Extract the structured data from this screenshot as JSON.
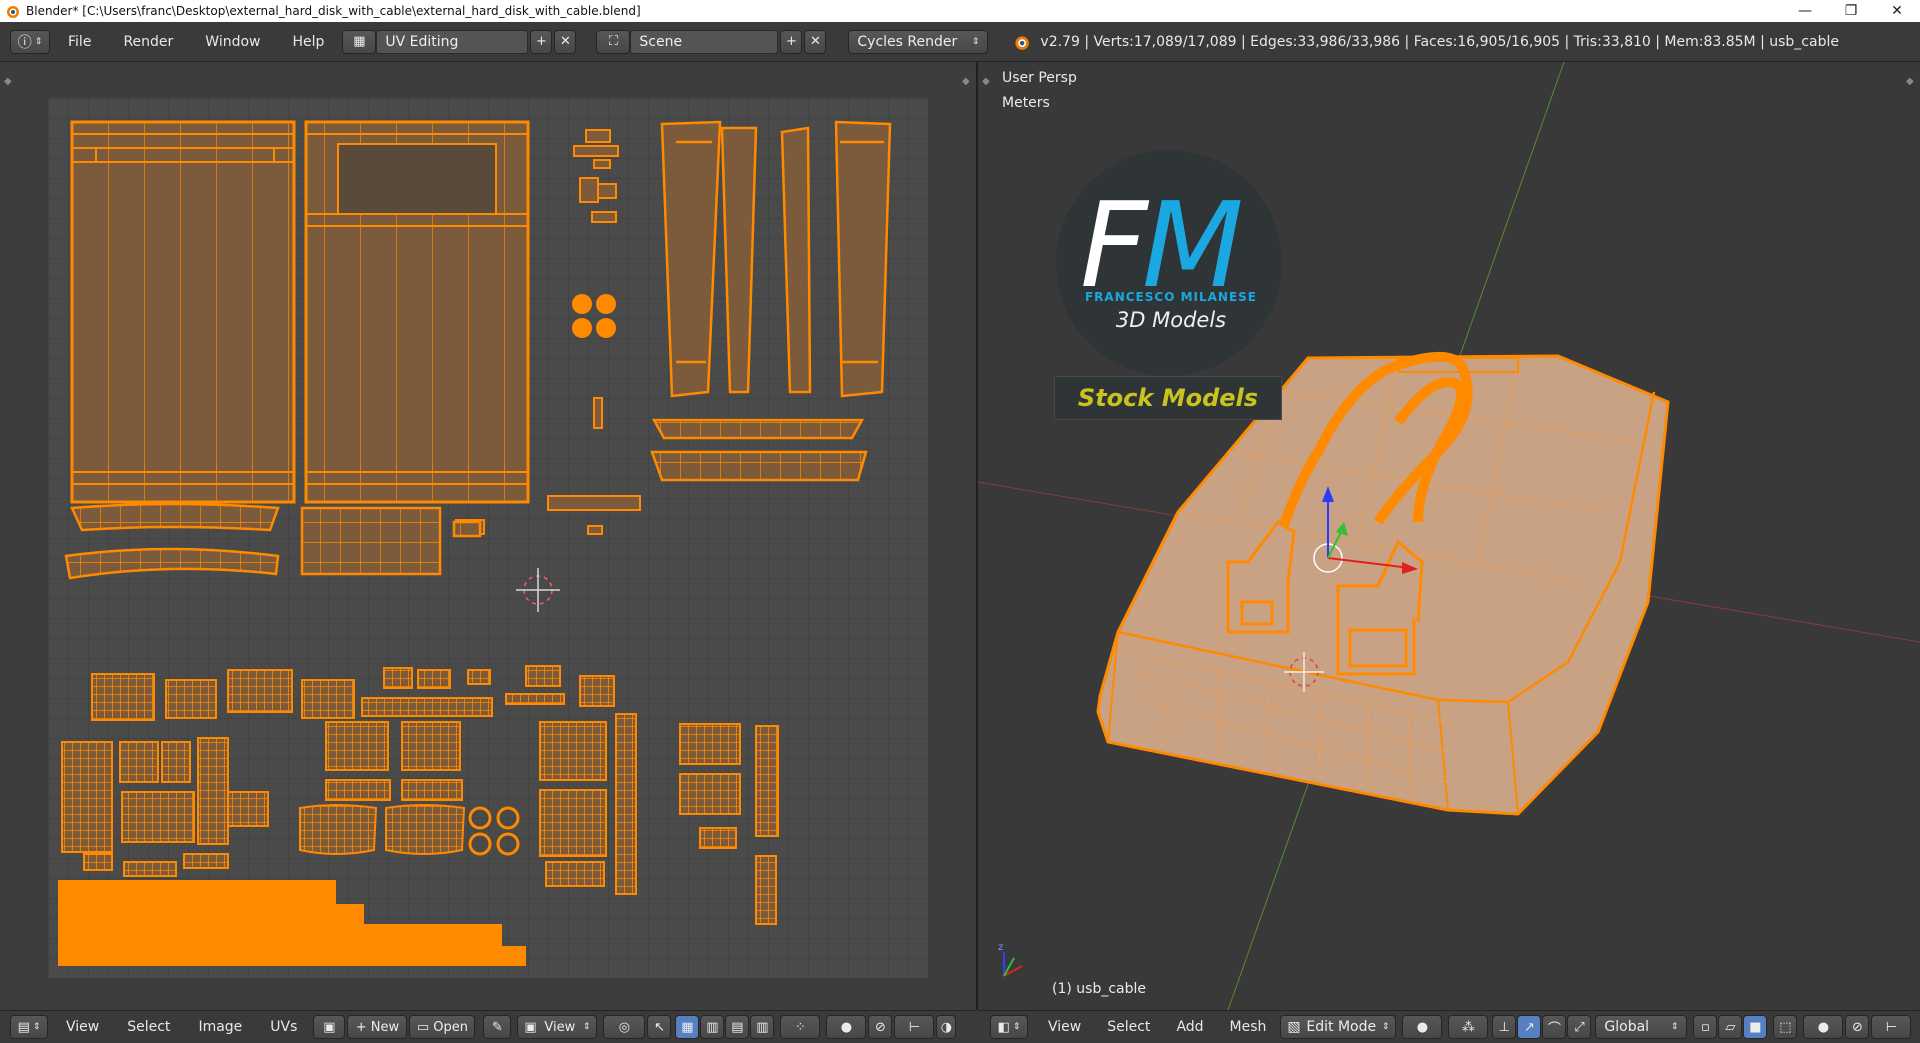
{
  "window": {
    "title": "Blender* [C:\\Users\\franc\\Desktop\\external_hard_disk_with_cable\\external_hard_disk_with_cable.blend]",
    "controls": {
      "minimize": "—",
      "restore": "❐",
      "close": "✕"
    }
  },
  "topbar": {
    "menus": [
      "File",
      "Render",
      "Window",
      "Help"
    ],
    "screen_layout": "UV Editing",
    "scene": "Scene",
    "render_engine": "Cycles Render",
    "stats": "v2.79 | Verts:17,089/17,089 | Edges:33,986/33,986 | Faces:16,905/16,905 | Tris:33,810 | Mem:83.85M | usb_cable"
  },
  "uv_editor": {
    "header_menus": [
      "View",
      "Select",
      "Image",
      "UVs"
    ],
    "new_label": "New",
    "open_label": "Open",
    "view_label": "View"
  },
  "view3d": {
    "view_name": "User Persp",
    "units": "Meters",
    "object_label": "(1) usb_cable",
    "header_menus": [
      "View",
      "Select",
      "Add",
      "Mesh"
    ],
    "mode": "Edit Mode",
    "orientation": "Global"
  },
  "watermark": {
    "letters": "FM",
    "author": "FRANCESCO MILANESE",
    "subtitle": "3D Models",
    "banner": "Stock Models"
  },
  "colors": {
    "uv_orange": "#ff8a00",
    "uv_fill": "#7b5b3b",
    "mesh_fill": "#c9a183",
    "logo_blue": "#1ba7e0",
    "banner_yellow": "#c8c31e"
  }
}
